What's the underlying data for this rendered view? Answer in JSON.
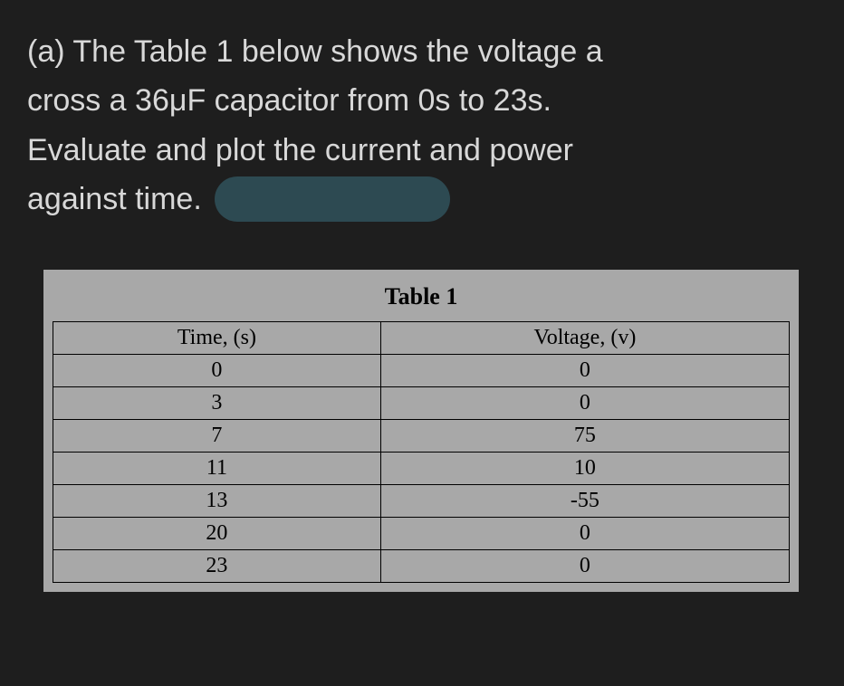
{
  "question": {
    "line1": "(a) The Table 1 below shows the voltage a",
    "line2": "cross a 36μF capacitor from 0s to 23s.",
    "line3": "Evaluate and plot the current and power",
    "line4": "against time."
  },
  "table": {
    "title": "Table 1",
    "headers": [
      "Time, (s)",
      "Voltage, (v)"
    ],
    "rows": [
      [
        "0",
        "0"
      ],
      [
        "3",
        "0"
      ],
      [
        "7",
        "75"
      ],
      [
        "11",
        "10"
      ],
      [
        "13",
        "-55"
      ],
      [
        "20",
        "0"
      ],
      [
        "23",
        "0"
      ]
    ]
  },
  "chart_data": {
    "type": "table",
    "title": "Table 1",
    "columns": [
      "Time, (s)",
      "Voltage, (v)"
    ],
    "data": [
      {
        "time_s": 0,
        "voltage_v": 0
      },
      {
        "time_s": 3,
        "voltage_v": 0
      },
      {
        "time_s": 7,
        "voltage_v": 75
      },
      {
        "time_s": 11,
        "voltage_v": 10
      },
      {
        "time_s": 13,
        "voltage_v": -55
      },
      {
        "time_s": 20,
        "voltage_v": 0
      },
      {
        "time_s": 23,
        "voltage_v": 0
      }
    ]
  }
}
